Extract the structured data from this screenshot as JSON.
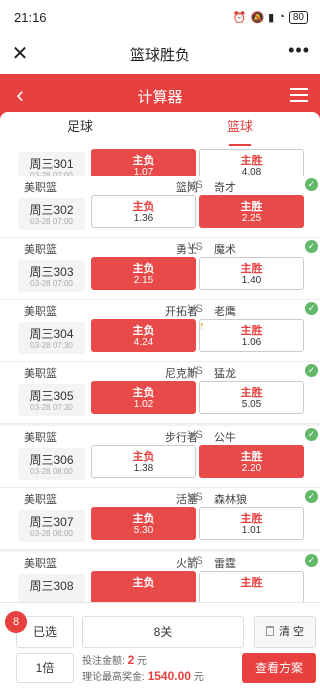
{
  "status": {
    "time": "21:16",
    "battery": "80"
  },
  "app": {
    "title": "篮球胜负",
    "more": "•••",
    "close": "✕"
  },
  "calc": {
    "title": "计算器"
  },
  "tabs": [
    {
      "label": "足球"
    },
    {
      "label": "篮球"
    }
  ],
  "colors": {
    "accent": "#e8403f",
    "check": "#62b86a"
  },
  "matches": [
    {
      "league": "",
      "home": "",
      "away": "",
      "id": "周三301",
      "date": "03-28 07:00",
      "lose_label": "主负",
      "lose_odds": "1.07",
      "win_label": "主胜",
      "win_odds": "4.08",
      "selected": "lose"
    },
    {
      "league": "美职篮",
      "home": "篮网",
      "away": "奇才",
      "id": "周三302",
      "date": "03-28 07:00",
      "lose_label": "主负",
      "lose_odds": "1.36",
      "win_label": "主胜",
      "win_odds": "2.25",
      "selected": "win"
    },
    {
      "league": "美职篮",
      "home": "勇士",
      "away": "魔术",
      "id": "周三303",
      "date": "03-28 07:00",
      "lose_label": "主负",
      "lose_odds": "2.15",
      "win_label": "主胜",
      "win_odds": "1.40",
      "selected": "lose"
    },
    {
      "league": "美职篮",
      "home": "开拓者",
      "away": "老鹰",
      "id": "周三304",
      "date": "03-28 07:30",
      "lose_label": "主负",
      "lose_odds": "4.24",
      "win_label": "主胜",
      "win_odds": "1.06",
      "selected": "lose",
      "arrow": "↑"
    },
    {
      "league": "美职篮",
      "home": "尼克斯",
      "away": "猛龙",
      "id": "周三305",
      "date": "03-28 07:30",
      "lose_label": "主负",
      "lose_odds": "1.02",
      "win_label": "主胜",
      "win_odds": "5.05",
      "selected": "lose"
    },
    {
      "league": "美职篮",
      "home": "步行者",
      "away": "公牛",
      "id": "周三306",
      "date": "03-28 08:00",
      "lose_label": "主负",
      "lose_odds": "1.38",
      "win_label": "主胜",
      "win_odds": "2.20",
      "selected": "win"
    },
    {
      "league": "美职篮",
      "home": "活塞",
      "away": "森林狼",
      "id": "周三307",
      "date": "03-28 08:00",
      "lose_label": "主负",
      "lose_odds": "5.30",
      "win_label": "主胜",
      "win_odds": "1.01",
      "selected": "lose"
    },
    {
      "league": "美职篮",
      "home": "火箭",
      "away": "雷霆",
      "id": "周三308",
      "date": "",
      "lose_label": "主负",
      "lose_odds": "",
      "win_label": "主胜",
      "win_odds": "",
      "selected": "lose"
    }
  ],
  "vs": "VS",
  "footer": {
    "count": "8",
    "chosen_label": "已选",
    "pass_label": "8关",
    "clear_label": "清 空",
    "multiplier": "1倍",
    "bet_label": "投注金额:",
    "bet_amount": "2",
    "bet_unit": "元",
    "prize_label": "理论最高奖金:",
    "prize_amount": "1540.00",
    "prize_unit": "元",
    "view_label": "查看方案"
  }
}
